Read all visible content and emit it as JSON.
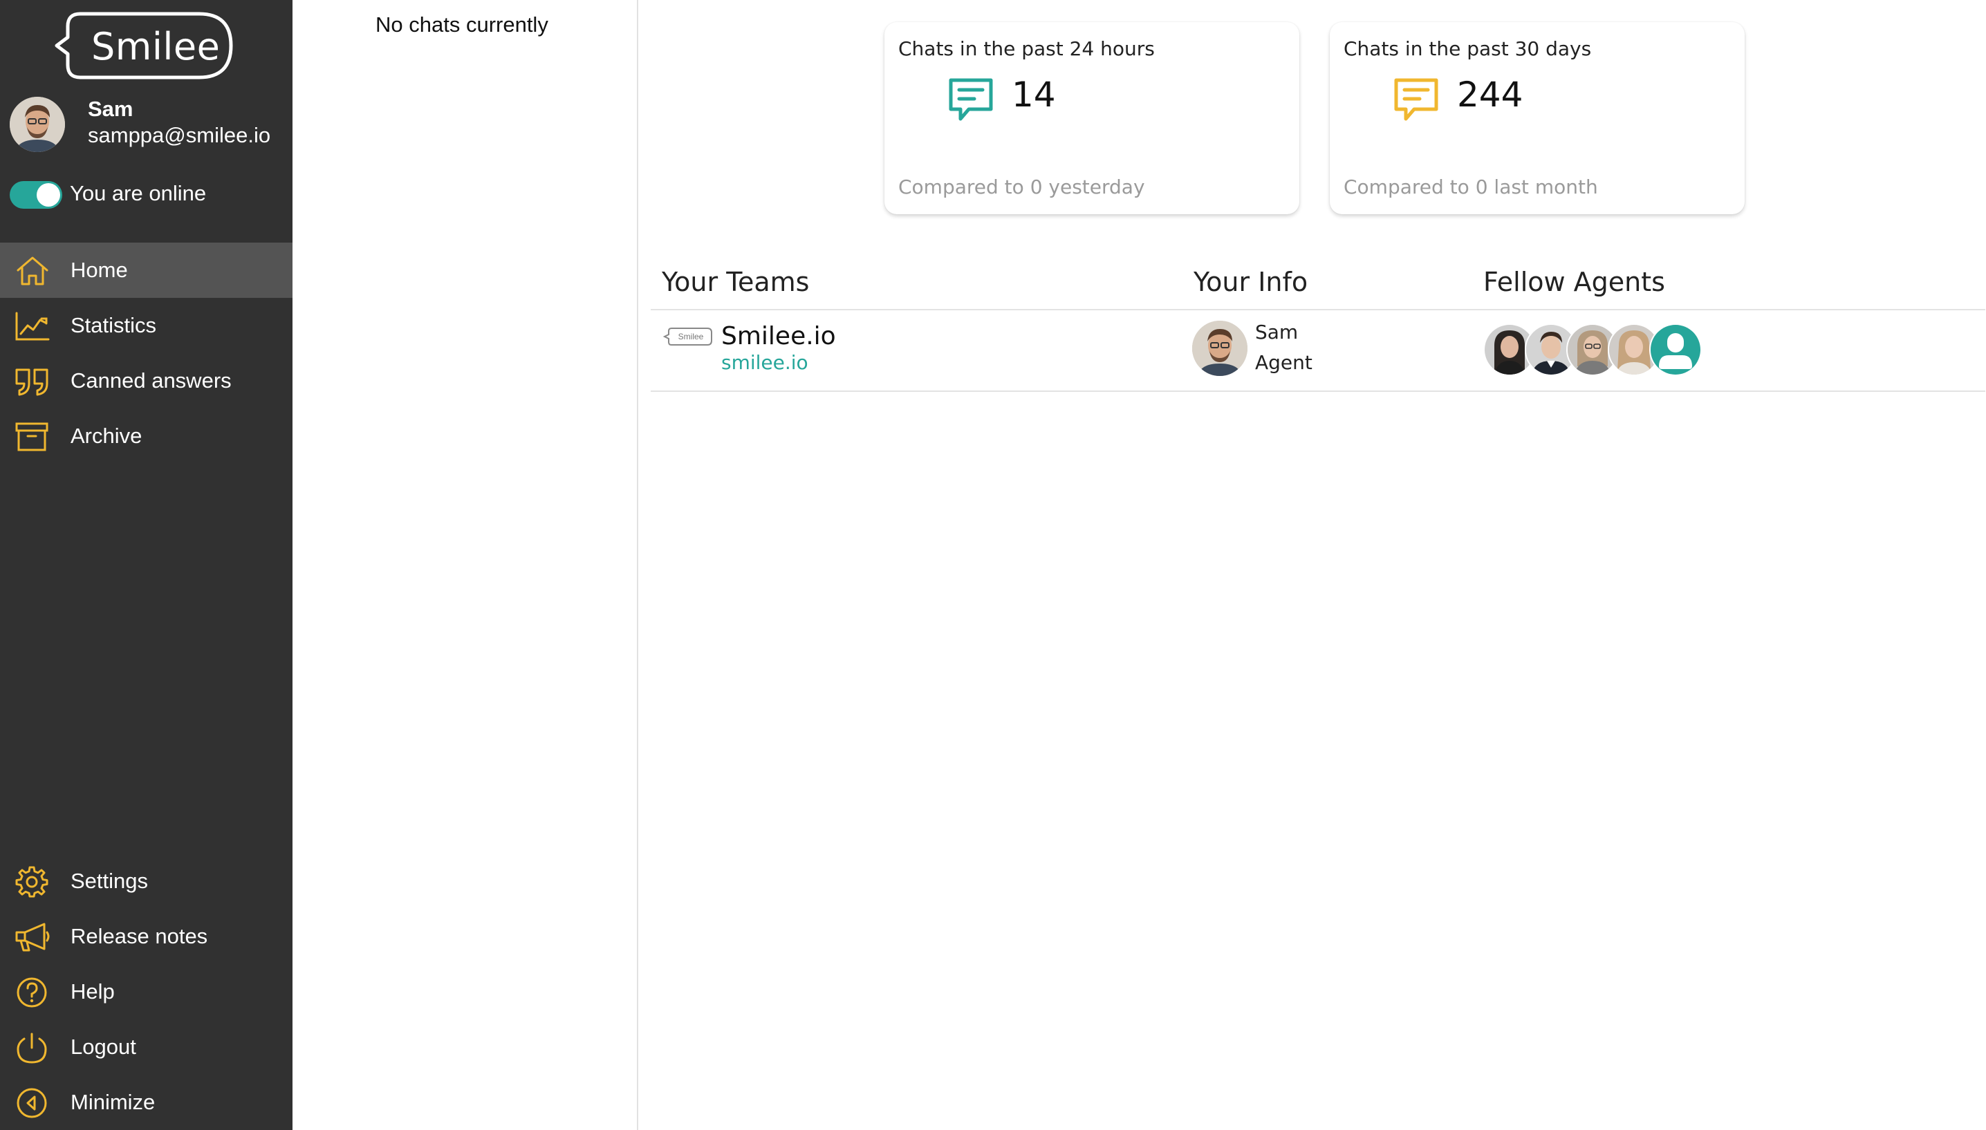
{
  "brand": {
    "logo_text": "Smilee",
    "accent": "#26a69a",
    "icon_color": "#f0b72f",
    "sidebar_bg": "#313131"
  },
  "user": {
    "name": "Sam",
    "email": "samppa@smilee.io",
    "avatar": "user-avatar-photo",
    "online_toggle": true,
    "online_label": "You are online"
  },
  "nav": {
    "top": [
      {
        "label": "Home",
        "icon": "home-icon",
        "active": true
      },
      {
        "label": "Statistics",
        "icon": "chart-icon",
        "active": false
      },
      {
        "label": "Canned answers",
        "icon": "quote-icon",
        "active": false
      },
      {
        "label": "Archive",
        "icon": "archive-icon",
        "active": false
      }
    ],
    "bottom": [
      {
        "label": "Settings",
        "icon": "gear-icon"
      },
      {
        "label": "Release notes",
        "icon": "megaphone-icon"
      },
      {
        "label": "Help",
        "icon": "help-icon"
      },
      {
        "label": "Logout",
        "icon": "power-icon"
      },
      {
        "label": "Minimize",
        "icon": "minimize-icon"
      }
    ]
  },
  "chats": {
    "empty_label": "No chats currently"
  },
  "stats": [
    {
      "title": "Chats in the past 24 hours",
      "count": "14",
      "comparison": "Compared to 0 yesterday",
      "icon": "chat-bubble-icon",
      "icon_color": "#26a69a"
    },
    {
      "title": "Chats in the past 30 days",
      "count": "244",
      "comparison": "Compared to 0 last month",
      "icon": "chat-bubble-icon",
      "icon_color": "#f0b72f"
    }
  ],
  "sections": {
    "teams": "Your Teams",
    "info": "Your Info",
    "agents": "Fellow Agents"
  },
  "team": {
    "logo_text": "Smilee",
    "name": "Smilee.io",
    "url": "smilee.io"
  },
  "info": {
    "name": "Sam",
    "role": "Agent"
  },
  "fellow_agents": [
    {
      "avatar": "agent-avatar-1"
    },
    {
      "avatar": "agent-avatar-2"
    },
    {
      "avatar": "agent-avatar-3"
    },
    {
      "avatar": "agent-avatar-4"
    },
    {
      "avatar": "agent-avatar-placeholder"
    }
  ]
}
